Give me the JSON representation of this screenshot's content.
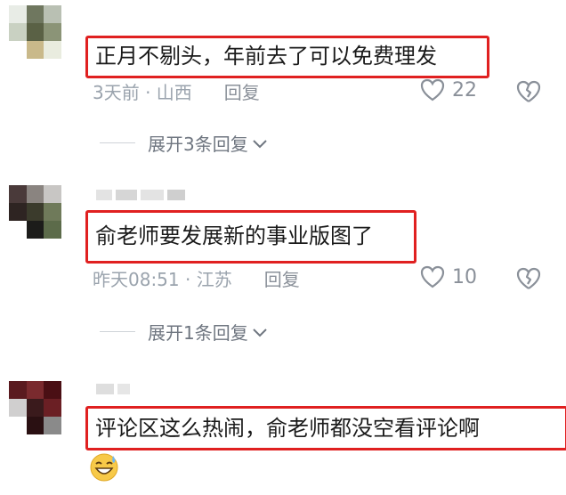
{
  "comments": [
    {
      "text": "正月不剔头，年前去了可以免费理发",
      "time_location": "3天前 · 山西",
      "reply_label": "回复",
      "likes": "22",
      "expand_label": "展开3条回复"
    },
    {
      "text": "俞老师要发展新的事业版图了",
      "time_location": "昨天08:51 · 江苏",
      "reply_label": "回复",
      "likes": "10",
      "expand_label": "展开1条回复"
    },
    {
      "text": "评论区这么热闹，俞老师都没空看评论啊",
      "emoji": "grinning-sweat-emoji"
    }
  ],
  "colors": {
    "highlight_border": "#e02020",
    "meta_text": "#9aa3ad",
    "icon": "#8a9099"
  }
}
